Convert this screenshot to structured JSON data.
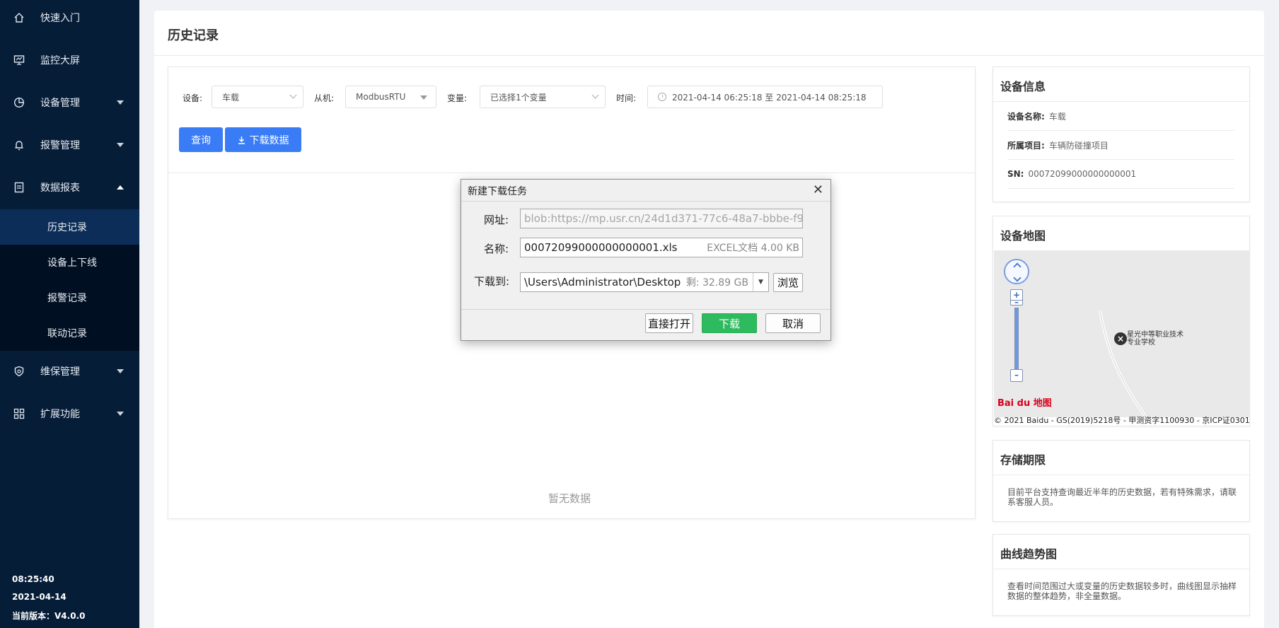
{
  "sidebar": {
    "items": [
      {
        "label": "快速入门",
        "icon": "home-icon"
      },
      {
        "label": "监控大屏",
        "icon": "monitor-icon"
      },
      {
        "label": "设备管理",
        "icon": "pie-chart-icon"
      },
      {
        "label": "报警管理",
        "icon": "bell-icon"
      },
      {
        "label": "数据报表",
        "icon": "report-icon"
      },
      {
        "label": "维保管理",
        "icon": "shield-icon"
      },
      {
        "label": "扩展功能",
        "icon": "apps-icon"
      }
    ],
    "submenu": [
      "历史记录",
      "设备上下线",
      "报警记录",
      "联动记录"
    ],
    "footer": {
      "time": "08:25:40",
      "date": "2021-04-14",
      "version": "当前版本：V4.0.0"
    }
  },
  "page": {
    "title": "历史记录",
    "filters": {
      "device_label": "设备:",
      "device_value": "车载",
      "slave_label": "从机:",
      "slave_value": "ModbusRTU",
      "variable_label": "变量:",
      "variable_value": "已选择1个变量",
      "time_label": "时间:",
      "time_value": "2021-04-14 06:25:18 至 2021-04-14 08:25:18"
    },
    "buttons": {
      "query": "查询",
      "download": "下载数据"
    },
    "empty_text": "暂无数据"
  },
  "device_info": {
    "title": "设备信息",
    "rows": [
      {
        "key": "设备名称:",
        "value": "车载"
      },
      {
        "key": "所属项目:",
        "value": "车辆防碰撞项目"
      },
      {
        "key": "SN:",
        "value": "00072099000000000001"
      }
    ]
  },
  "device_map": {
    "title": "设备地图",
    "poi": "星光中等职业技术专业学校",
    "logo": "Bai du 地图",
    "copyright": "© 2021 Baidu - GS(2019)5218号 - 甲测资字1100930 - 京ICP证0301"
  },
  "storage": {
    "title": "存储期限",
    "text": "目前平台支持查询最近半年的历史数据，若有特殊需求，请联系客服人员。"
  },
  "trend": {
    "title": "曲线趋势图",
    "text": "查看时间范围过大或变量的历史数据较多时，曲线图显示抽样数据的整体趋势，非全量数据。"
  },
  "dialog": {
    "title": "新建下载任务",
    "url_label": "网址:",
    "url_value": "blob:https://mp.usr.cn/24d1d371-77c6-48a7-bbbe-f9",
    "name_label": "名称:",
    "name_value": "00072099000000000001.xls",
    "name_hint": "EXCEL文档 4.00 KB",
    "path_label": "下载到:",
    "path_value": "\\Users\\Administrator\\Desktop",
    "path_hint": "剩: 32.89 GB",
    "browse": "浏览",
    "open": "直接打开",
    "download": "下载",
    "cancel": "取消"
  }
}
